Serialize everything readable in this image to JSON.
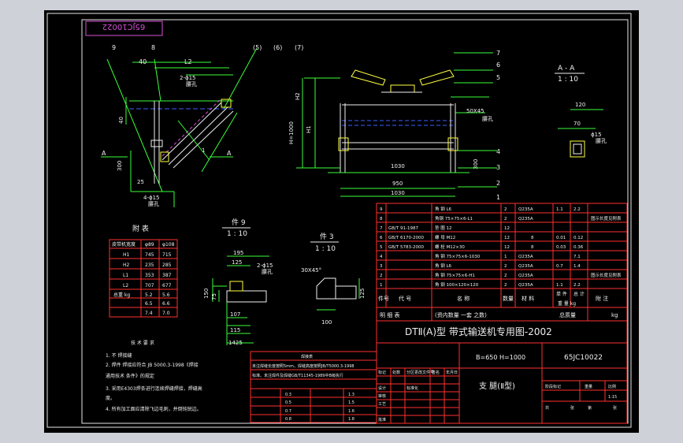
{
  "drawing_no_header": "65JC10022",
  "main_view": {
    "labels": [
      "9",
      "8",
      "40",
      "L2",
      "(5)",
      "(6)",
      "(7)",
      "2-ϕ15",
      "腰孔",
      "A",
      "A",
      "300",
      "25",
      "4-ϕ15",
      "腰孔",
      "40",
      "1"
    ]
  },
  "front_view": {
    "labels": [
      "H2",
      "H1",
      "H=1000",
      "1030",
      "950",
      "1030",
      "50X45",
      "腰孔",
      "7",
      "6",
      "5",
      "4",
      "3",
      "2",
      "1",
      "300"
    ]
  },
  "section_aa": {
    "title": "A - A",
    "scale": "1 : 10",
    "dims": [
      "120",
      "70",
      "ϕ15",
      "腰孔"
    ]
  },
  "detail_9": {
    "title": "件 9",
    "scale": "1 : 10",
    "dims": [
      "195",
      "125",
      "2-ϕ15",
      "腰孔",
      "150",
      "75",
      "107",
      "115",
      "1425"
    ]
  },
  "detail_3": {
    "title": "件 3",
    "scale": "1 : 10",
    "dims": [
      "30X45°",
      "100",
      "125"
    ]
  },
  "appendix_table": {
    "title": "附 表",
    "headers": [
      "皮带机宽度",
      "φ89",
      "φ108"
    ],
    "rows": [
      [
        "H1",
        "745",
        "715"
      ],
      [
        "H2",
        "235",
        "285"
      ],
      [
        "L1",
        "353",
        "387"
      ],
      [
        "L2",
        "707",
        "677"
      ],
      [
        "总重 kg",
        "5.2",
        "5.6"
      ],
      [
        "",
        "6.5",
        "6.6"
      ],
      [
        "",
        "7.4",
        "7.0"
      ]
    ]
  },
  "tech_notes": {
    "title": "技 术 要 求",
    "lines": [
      "1. 不 焊接缝",
      "2. 焊件 焊接应符合 JB 5000.3-1998《焊接",
      "通用技术 条件》的规定",
      "3. 采用E4303焊条进行连续焊缝焊接，焊缝高",
      "度。",
      "4. 所有加工面应清除飞边毛刺，并倒钝锐边。"
    ]
  },
  "weld_table": {
    "title": "焊接表",
    "rows": [
      [
        "未注焊缝长度按照5mm，焊缝高度按照JB/T5000.3-1998",
        "",
        ""
      ],
      [
        "标准。未注焊件及焊缝GB/T11345-1989中B级执行",
        "",
        ""
      ],
      [
        "",
        "0.3",
        "1.3"
      ],
      [
        "",
        "0.5",
        "1.5"
      ],
      [
        "",
        "0.7",
        "1.6"
      ],
      [
        "",
        "0.8",
        "1.8"
      ]
    ]
  },
  "bom": {
    "rows": [
      [
        "9",
        "",
        "角 钢 L6",
        "2",
        "Q235A",
        "1.1",
        "2.2",
        ""
      ],
      [
        "8",
        "",
        "角钢 75×75×6-L1",
        "2",
        "Q235A",
        "",
        "",
        "图示长度见附表"
      ],
      [
        "7",
        "GB/T 91-1987",
        "垫 圈 12",
        "12",
        "",
        "",
        "",
        ""
      ],
      [
        "6",
        "GB/T 6170-2000",
        "螺 母 M12",
        "12",
        "8",
        "0.01",
        "0.12",
        ""
      ],
      [
        "5",
        "GB/T 5783-2000",
        "螺 栓 M12×30",
        "12",
        "8",
        "0.03",
        "0.36",
        ""
      ],
      [
        "4",
        "",
        "角 钢 75×75×6-1030",
        "1",
        "Q235A",
        "",
        "7.1",
        ""
      ],
      [
        "3",
        "",
        "角 钢 L6",
        "2",
        "Q235A",
        "0.7",
        "1.4",
        ""
      ],
      [
        "2",
        "",
        "角 钢 75×75×6-H1",
        "2",
        "Q235A",
        "",
        "",
        "图示长度见附表"
      ],
      [
        "1",
        "",
        "角 钢 100×120×120",
        "2",
        "Q235A",
        "1.1",
        "2.2",
        ""
      ]
    ],
    "header": [
      "件号",
      "代 号",
      "名 称",
      "数量",
      "材 料",
      "单 件",
      "总 计",
      "附 注"
    ],
    "header_sub": [
      "重 量 kg"
    ],
    "footer_row": [
      "明 细 表",
      "(资内数量 一套 之数)",
      "总质量",
      "kg"
    ]
  },
  "title_block": {
    "title": "DTⅡ(A)型 带式输送机专用图-2002",
    "spec": "B=650 H=1000",
    "drawing_no": "65JC10022",
    "part_name": "支 腿(Ⅱ型)",
    "labels_left": [
      "标记",
      "处数",
      "分区",
      "更改文件号",
      "签名",
      "年月日",
      "设计",
      "审核",
      "工艺",
      "标准化",
      "批准"
    ],
    "labels_right": [
      "阶段标记",
      "重量",
      "比例",
      "1:15",
      "共",
      "张",
      "第",
      "张"
    ]
  }
}
